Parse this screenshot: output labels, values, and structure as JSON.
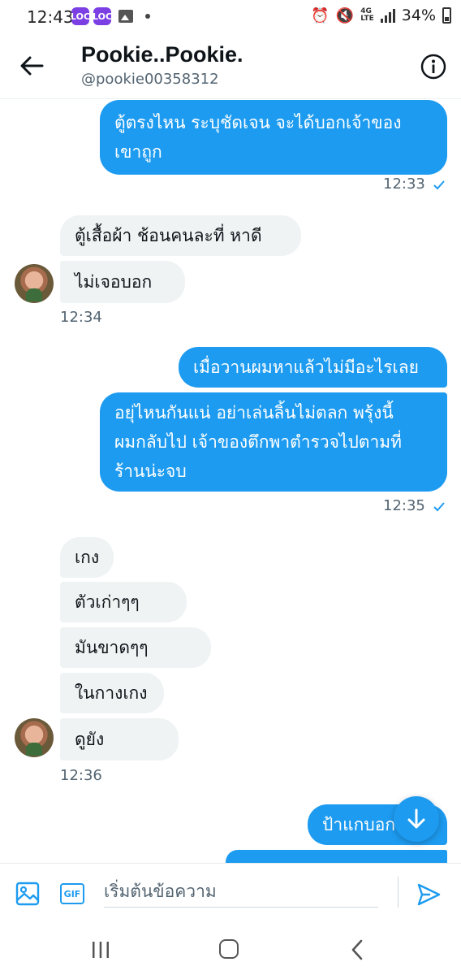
{
  "status_bar": {
    "time": "12:43",
    "app_badge_label": "LOC",
    "network": "4G",
    "network_sub": "LTE",
    "battery": "34%"
  },
  "header": {
    "title": "Pookie..Pookie.",
    "handle": "@pookie00358312",
    "back_icon": "arrow-left-icon",
    "info_icon": "info-icon"
  },
  "messages": [
    {
      "side": "sent",
      "text_line1": "ตู้ตรงไหน  ระบุชัดเจน จะได้บอกเจ้าของ",
      "text_line2": "เขาถูก"
    },
    {
      "side": "sent_time",
      "time": "12:33"
    },
    {
      "side": "received",
      "text": "ตู้เสื้อผ้า  ช้อนคนละที่  หาดี"
    },
    {
      "side": "received",
      "text": "ไม่เจอบอก"
    },
    {
      "side": "received_time",
      "time": "12:34"
    },
    {
      "side": "sent",
      "text": "เมื่อวานผมหาแล้วไม่มีอะไรเลย"
    },
    {
      "side": "sent",
      "text_line1": "อยุ่ไหนกันแน่ อย่าเล่นลิ้นไม่ตลก พรุ้งนี้",
      "text_line2": "ผมกลับไป เจ้าของตึกพาตำรวจไปตามที่",
      "text_line3": "ร้านน่ะจบ"
    },
    {
      "side": "sent_time",
      "time": "12:35"
    },
    {
      "side": "received",
      "text": "เกง"
    },
    {
      "side": "received",
      "text": "ตัวเก่าๆๆ"
    },
    {
      "side": "received",
      "text": "มันขาดๆๆ"
    },
    {
      "side": "received",
      "text": "ในกางเกง"
    },
    {
      "side": "received",
      "text": "ดูยัง"
    },
    {
      "side": "received_time",
      "time": "12:36"
    },
    {
      "side": "sent",
      "text": "ป้าแกบอก"
    }
  ],
  "composer": {
    "placeholder": "เริ่มต้นข้อความ",
    "gif_label": "GIF"
  },
  "colors": {
    "accent": "#1d9bf0",
    "received_bg": "#eff3f4",
    "muted_text": "#536471"
  }
}
